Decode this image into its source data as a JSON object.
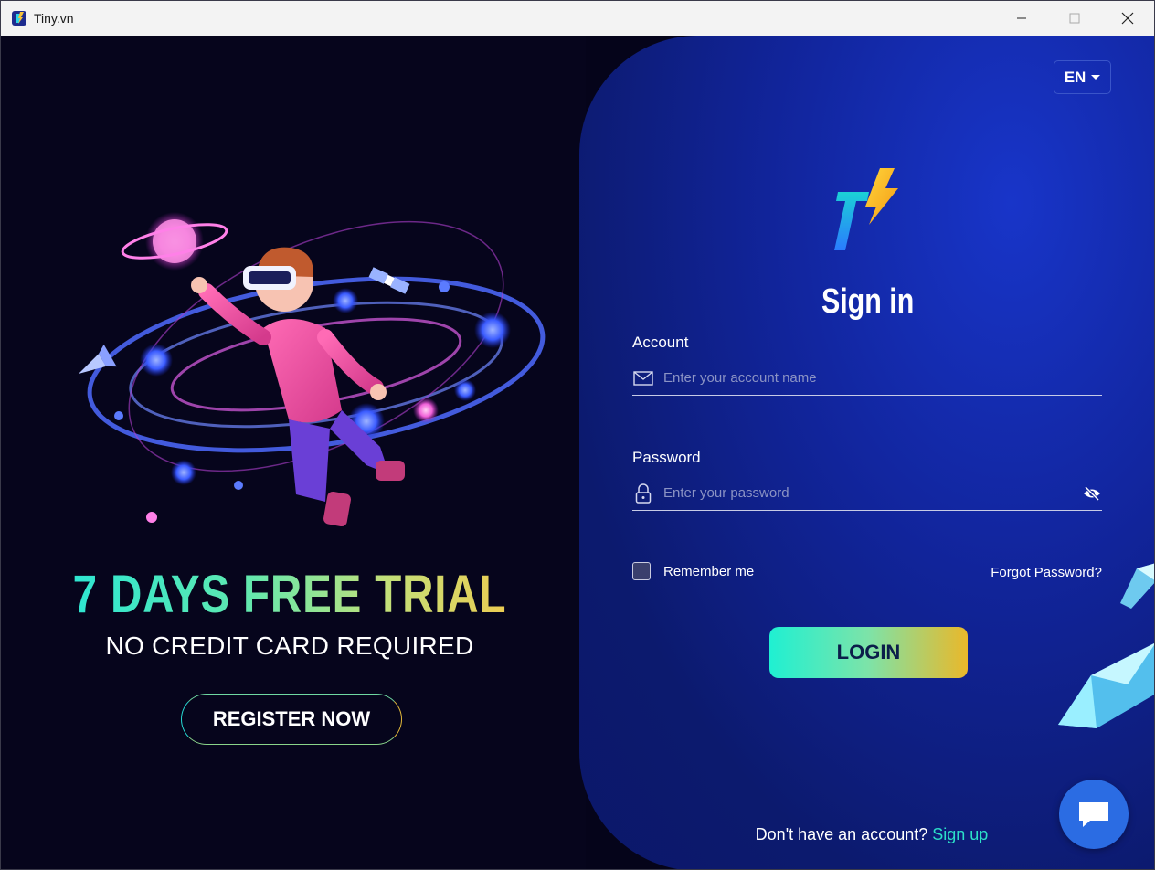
{
  "window": {
    "title": "Tiny.vn"
  },
  "promo": {
    "title": "7 DAYS FREE TRIAL",
    "subtitle": "NO CREDIT CARD REQUIRED",
    "register_label": "REGISTER NOW"
  },
  "language": {
    "selected": "EN"
  },
  "signin": {
    "title": "Sign in",
    "account_label": "Account",
    "account_placeholder": "Enter your account name",
    "password_label": "Password",
    "password_placeholder": "Enter your password",
    "remember_label": "Remember me",
    "forgot_label": "Forgot Password?",
    "login_label": "LOGIN",
    "no_account_text": "Don't have an account?",
    "signup_label": "Sign up"
  },
  "colors": {
    "accent_cyan": "#1ff0d2",
    "accent_gold": "#eab82a",
    "panel_blue": "#11249a",
    "chat_blue": "#2b6ce3"
  },
  "icons": {
    "app": "tiny-logo-icon",
    "minimize": "minimize-icon",
    "maximize": "maximize-icon",
    "close": "close-icon",
    "account": "envelope-icon",
    "password": "lock-icon",
    "toggle_password": "eye-slash-icon",
    "chat": "chat-icon"
  }
}
